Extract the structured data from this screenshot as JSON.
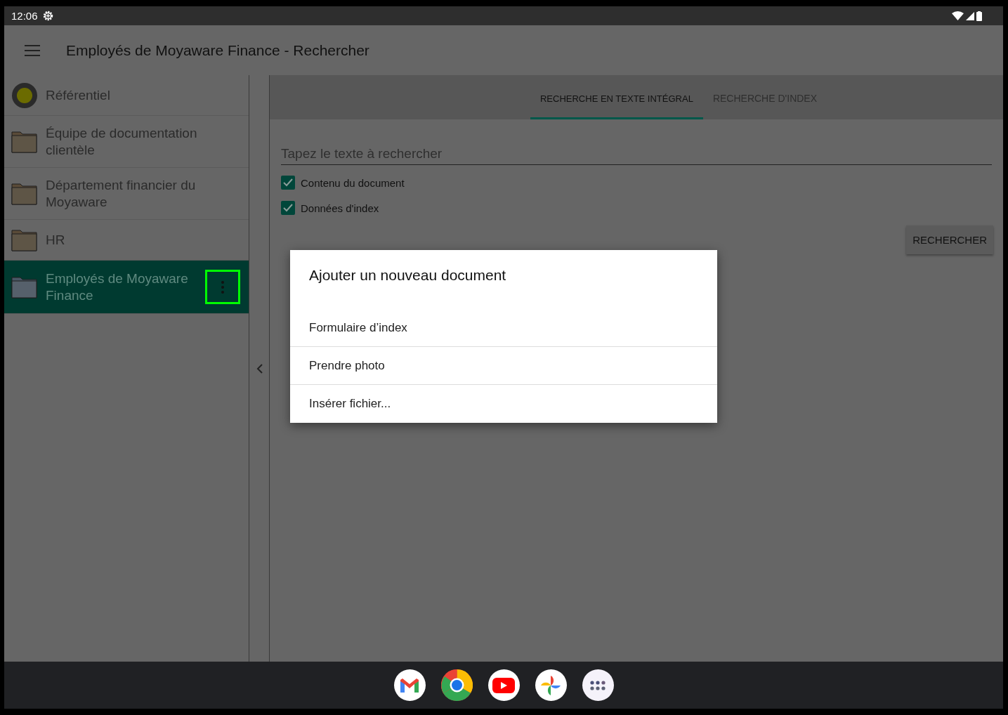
{
  "status_bar": {
    "time": "12:06"
  },
  "app_bar": {
    "title": "Employés de Moyaware Finance - Rechercher"
  },
  "sidebar": {
    "items": [
      {
        "label": "Référentiel",
        "kind": "repository",
        "selected": false
      },
      {
        "label": "Équipe de documentation clientèle",
        "kind": "folder",
        "selected": false
      },
      {
        "label": "Département financier du Moyaware",
        "kind": "folder",
        "selected": false
      },
      {
        "label": "HR",
        "kind": "folder",
        "selected": false
      },
      {
        "label": "Employés de Moyaware Finance",
        "kind": "folder",
        "selected": true
      }
    ]
  },
  "tabs": [
    {
      "label": "RECHERCHE EN TEXTE INTÉGRAL",
      "selected": true
    },
    {
      "label": "RECHERCHE D'INDEX",
      "selected": false
    }
  ],
  "search": {
    "placeholder": "Tapez le texte à rechercher"
  },
  "options": [
    {
      "label": "Contenu du document",
      "checked": true
    },
    {
      "label": "Données d'index",
      "checked": true
    }
  ],
  "search_button": "RECHERCHER",
  "dialog": {
    "title": "Ajouter un nouveau document",
    "items": [
      "Formulaire d’index",
      "Prendre photo",
      "Insérer fichier..."
    ]
  }
}
